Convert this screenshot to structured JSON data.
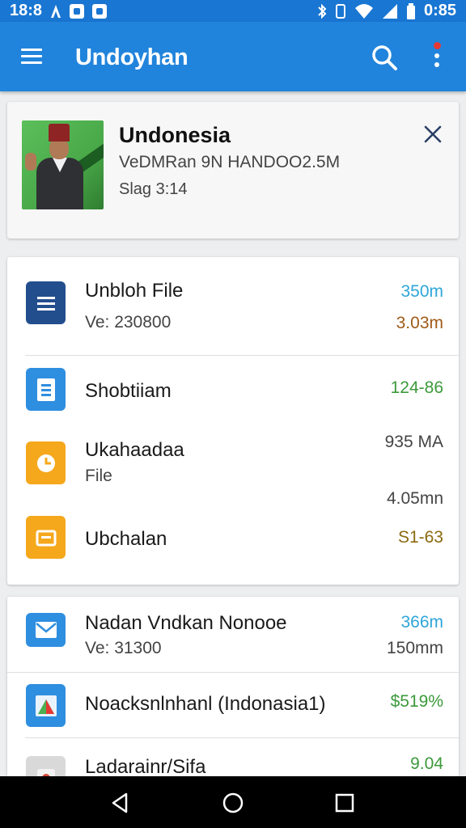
{
  "status_bar": {
    "time": "18:8",
    "clock_right": "0:85",
    "left_icons": [
      "a-icon",
      "notification-box-icon",
      "notification-box-icon"
    ],
    "right_icons": [
      "bluetooth-icon",
      "vibrate-icon",
      "wifi-icon",
      "signal-icon",
      "battery-icon"
    ]
  },
  "app_bar": {
    "title": "Undoyhan",
    "color": "#2184dc"
  },
  "featured": {
    "title": "Undonesia",
    "subtitle": "VeDMRan 9N HANDOO2.5M",
    "meta": "Slag 3:14"
  },
  "list1": [
    {
      "icon": "document-icon",
      "icon_color": "#234e8e",
      "title": "Unbloh File",
      "sub": "Ve: 230800",
      "value_top": "350m",
      "value_top_color": "#2ea6d8",
      "value_bottom": "3.03m",
      "value_bottom_color": "#a05a18"
    },
    {
      "icon": "file-icon",
      "icon_color": "#2e8ee0",
      "title": "Shobtiiam",
      "value_top": "124-86",
      "value_top_color": "#3c9a3c"
    },
    {
      "icon": "clock-icon",
      "icon_color": "#f5a81c",
      "title": "Ukahaadaa",
      "sub": "File",
      "value_top": "935 MA",
      "value_top_color": "#444444",
      "value_bottom": "4.05mn",
      "value_bottom_color": "#444444"
    },
    {
      "icon": "folder-icon",
      "icon_color": "#f5a81c",
      "title": "Ubchalan",
      "value_top": "S1-63",
      "value_top_color": "#8a6a10"
    }
  ],
  "list2": [
    {
      "icon": "mail-icon",
      "icon_color": "#2e8ee0",
      "title": "Nadan Vndkan Nonooe",
      "sub": "Ve: 31300",
      "value_top": "366m",
      "value_top_color": "#2ea6d8",
      "value_bottom": "150mm",
      "value_bottom_color": "#444444"
    },
    {
      "icon": "image-icon",
      "icon_color": "#2e8ee0",
      "title": "Noacksnlnhanl (Indonasia1)",
      "value_top": "$519%",
      "value_top_color": "#3c9a3c"
    },
    {
      "icon": "package-icon",
      "icon_color": "#d9d9d9",
      "title": "Ladarainr/Sifa",
      "value_top": "9.04",
      "value_top_color": "#3c9a3c"
    }
  ],
  "nav_bar": {
    "buttons": [
      "back-icon",
      "home-icon",
      "recents-icon"
    ]
  }
}
